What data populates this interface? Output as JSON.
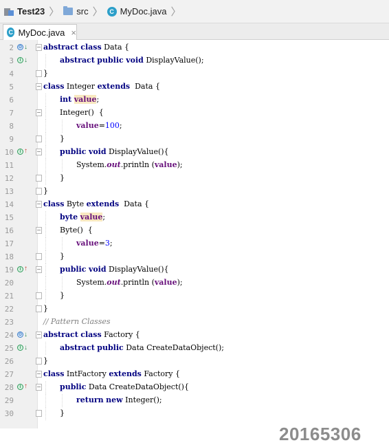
{
  "breadcrumb": {
    "project": "Test23",
    "folder": "src",
    "file": "MyDoc.java"
  },
  "tab": {
    "label": "MyDoc.java",
    "close": "×"
  },
  "icon_glyphs": {
    "class": "C",
    "implemented": "I",
    "overriding": "O"
  },
  "watermark": "20165306",
  "code_lines": [
    {
      "n": "2",
      "marker": "o-down"
    },
    {
      "n": "3",
      "marker": "i-down"
    },
    {
      "n": "4"
    },
    {
      "n": "5"
    },
    {
      "n": "6"
    },
    {
      "n": "7"
    },
    {
      "n": "8"
    },
    {
      "n": "9"
    },
    {
      "n": "10",
      "marker": "i-up"
    },
    {
      "n": "11"
    },
    {
      "n": "12"
    },
    {
      "n": "13"
    },
    {
      "n": "14"
    },
    {
      "n": "15"
    },
    {
      "n": "16"
    },
    {
      "n": "17"
    },
    {
      "n": "18"
    },
    {
      "n": "19",
      "marker": "i-up"
    },
    {
      "n": "20"
    },
    {
      "n": "21"
    },
    {
      "n": "22"
    },
    {
      "n": "23"
    },
    {
      "n": "24",
      "marker": "o-down"
    },
    {
      "n": "25",
      "marker": "i-down"
    },
    {
      "n": "26"
    },
    {
      "n": "27"
    },
    {
      "n": "28",
      "marker": "i-up"
    },
    {
      "n": "29"
    },
    {
      "n": "30"
    }
  ],
  "code": {
    "l2": {
      "k1": "abstract",
      "k2": "class",
      "t1": " Data {"
    },
    "l3": {
      "k1": "abstract",
      "k2": "public",
      "k3": "void",
      "t1": " DisplayValue();"
    },
    "l4": {
      "t1": "}"
    },
    "l5": {
      "k1": "class",
      "t1": " Integer ",
      "k2": "extends",
      "t2": "  Data {"
    },
    "l6": {
      "k1": "int",
      "f1": "value",
      "t1": ";"
    },
    "l7": {
      "t1": "Integer()  {"
    },
    "l8": {
      "f1": "value",
      "t1": "=",
      "n1": "100",
      "t2": ";"
    },
    "l9": {
      "t1": "}"
    },
    "l10": {
      "k1": "public",
      "k2": "void",
      "t1": " DisplayValue(){"
    },
    "l11": {
      "t1": "System.",
      "s1": "out",
      "t2": ".println (",
      "f1": "value",
      "t3": ");"
    },
    "l12": {
      "t1": "}"
    },
    "l13": {
      "t1": "}"
    },
    "l14": {
      "k1": "class",
      "t1": " Byte ",
      "k2": "extends",
      "t2": "  Data {"
    },
    "l15": {
      "k1": "byte",
      "f1": "value",
      "t1": ";"
    },
    "l16": {
      "t1": "Byte()  {"
    },
    "l17": {
      "f1": "value",
      "t1": "=",
      "n1": "3",
      "t2": ";"
    },
    "l18": {
      "t1": "}"
    },
    "l19": {
      "k1": "public",
      "k2": "void",
      "t1": " DisplayValue(){"
    },
    "l20": {
      "t1": "System.",
      "s1": "out",
      "t2": ".println (",
      "f1": "value",
      "t3": ");"
    },
    "l21": {
      "t1": "}"
    },
    "l22": {
      "t1": "}"
    },
    "l23": {
      "c1": "// Pattern Classes"
    },
    "l24": {
      "k1": "abstract",
      "k2": "class",
      "t1": " Factory {"
    },
    "l25": {
      "k1": "abstract",
      "k2": "public",
      "t1": " Data CreateDataObject();"
    },
    "l26": {
      "t1": "}"
    },
    "l27": {
      "k1": "class",
      "t1": " IntFactory ",
      "k2": "extends",
      "t2": " Factory {"
    },
    "l28": {
      "k1": "public",
      "t1": " Data CreateDataObject(){"
    },
    "l29": {
      "k1": "return",
      "k2": "new",
      "t1": " Integer();"
    },
    "l30": {
      "t1": "}"
    }
  }
}
